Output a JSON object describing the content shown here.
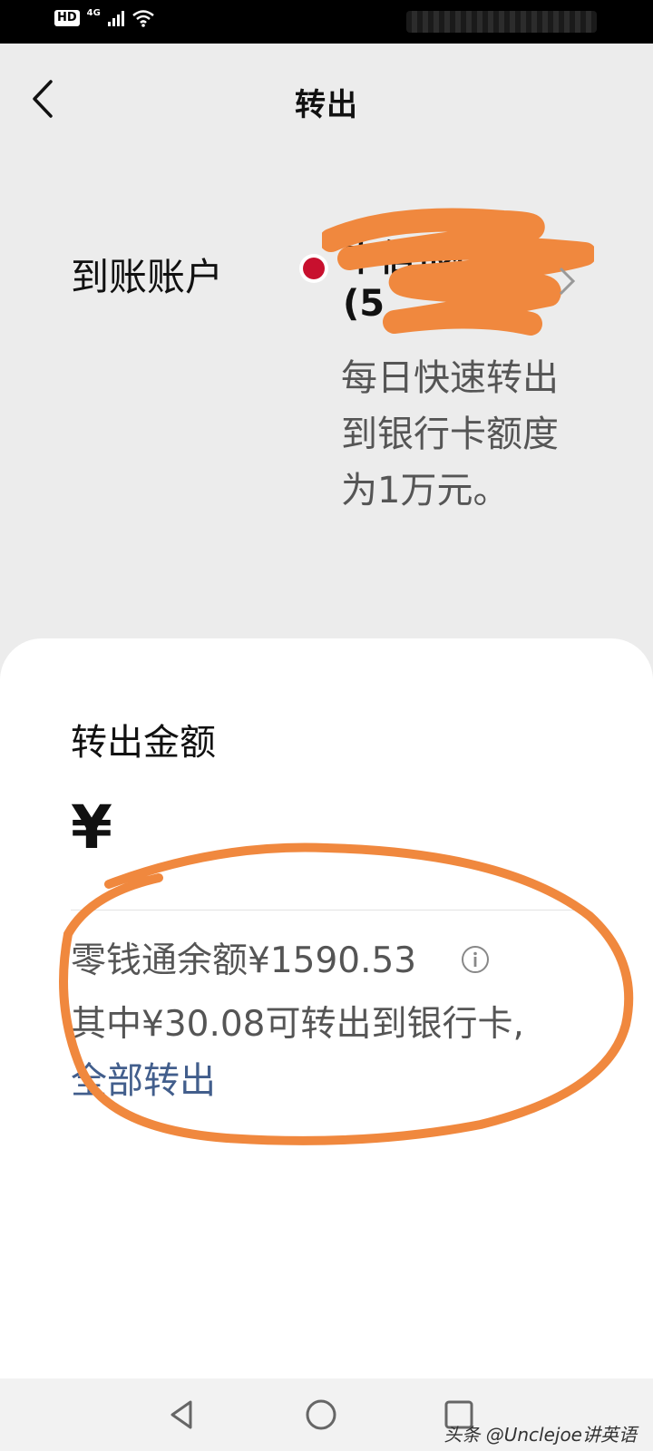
{
  "status_bar": {
    "hd": "HD",
    "network": "4G"
  },
  "header": {
    "title": "转出",
    "back_icon": "back-arrow-icon"
  },
  "account": {
    "label": "到账账户",
    "bank_name": "中信银行",
    "card_suffix": "(5",
    "limit_note": "每日快速转出到银行卡额度为1万元。",
    "bank_logo_color": "#c8102e"
  },
  "amount": {
    "label": "转出金额",
    "currency": "¥",
    "balance_text": "零钱通余额¥1590.53",
    "available_text": "其中¥30.08可转出到银行卡,",
    "withdraw_all_link": "全部转出",
    "link_color": "#425e8c"
  },
  "annotation_color": "#f0883e",
  "nav": {
    "back": "triangle-back-icon",
    "home": "circle-home-icon",
    "recents": "square-recents-icon"
  },
  "watermark": "头条 @Unclejoe讲英语"
}
